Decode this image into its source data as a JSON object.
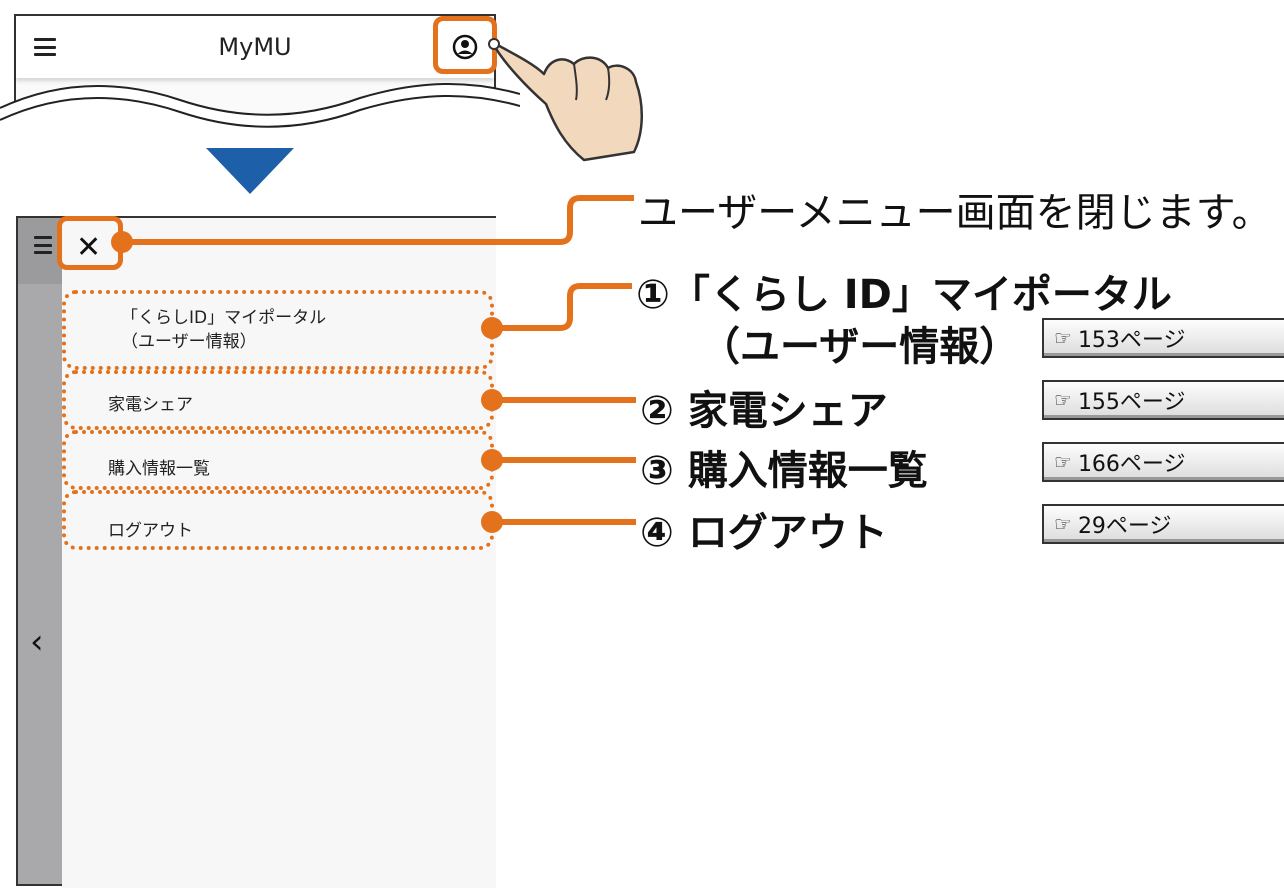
{
  "header": {
    "app_title": "MyMU"
  },
  "close_callout": {
    "text": "ユーザーメニュー画面を閉じます。"
  },
  "menu": {
    "items": [
      {
        "label_line1": "「くらしID」マイポータル",
        "label_line2": "（ユーザー情報）"
      },
      {
        "label": "家電シェア"
      },
      {
        "label": "購入情報一覧"
      },
      {
        "label": "ログアウト"
      }
    ]
  },
  "callouts": [
    {
      "number": "①",
      "label_line1": "「くらし ID」マイポータル",
      "label_line2": "（ユーザー情報）",
      "page_ref": "153ページ"
    },
    {
      "number": "②",
      "label": "家電シェア",
      "page_ref": "155ページ"
    },
    {
      "number": "③",
      "label": "購入情報一覧",
      "page_ref": "166ページ"
    },
    {
      "number": "④",
      "label": "ログアウト",
      "page_ref": "29ページ"
    }
  ],
  "colors": {
    "accent_orange": "#e4721c",
    "arrow_blue": "#1d5fa8"
  }
}
